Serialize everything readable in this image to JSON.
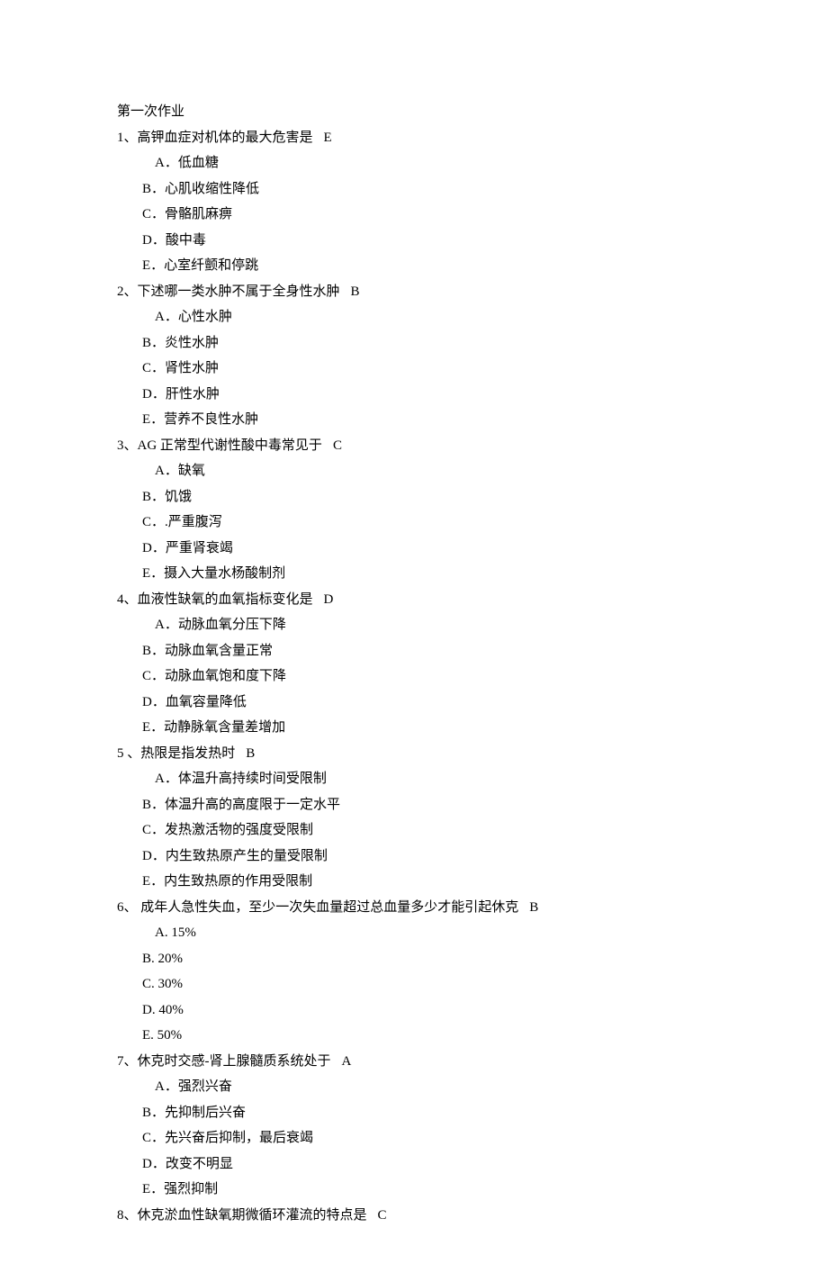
{
  "title": "第一次作业",
  "questions": [
    {
      "num": "1、",
      "stem": "高钾血症对机体的最大危害是",
      "answer": "E",
      "options": [
        "A．低血糖",
        "B．心肌收缩性降低",
        "C．骨骼肌麻痹",
        "D．酸中毒",
        "E．心室纤颤和停跳"
      ]
    },
    {
      "num": "2、",
      "stem": "下述哪一类水肿不属于全身性水肿",
      "answer": "B",
      "options": [
        "A．心性水肿",
        "B．炎性水肿",
        "C．肾性水肿",
        "D．肝性水肿",
        "E．营养不良性水肿"
      ]
    },
    {
      "num": "3、",
      "stem": "AG 正常型代谢性酸中毒常见于",
      "answer": "C",
      "options": [
        "A．缺氧",
        "B．饥饿",
        "C．.严重腹泻",
        "D．严重肾衰竭",
        "E．摄入大量水杨酸制剂"
      ]
    },
    {
      "num": "4、",
      "stem": "血液性缺氧的血氧指标变化是",
      "answer": "D",
      "options": [
        "A．动脉血氧分压下降",
        "B．动脉血氧含量正常",
        "C．动脉血氧饱和度下降",
        "D．血氧容量降低",
        "E．动静脉氧含量差增加"
      ]
    },
    {
      "num": "5 、",
      "stem": "热限是指发热时",
      "answer": "B",
      "options": [
        "A．体温升高持续时间受限制",
        "B．体温升高的高度限于一定水平",
        "C．发热激活物的强度受限制",
        "D．内生致热原产生的量受限制",
        "E．内生致热原的作用受限制"
      ]
    },
    {
      "num": "6、",
      "stem": " 成年人急性失血，至少一次失血量超过总血量多少才能引起休克",
      "answer": "B",
      "options": [
        "A. 15%",
        "B. 20%",
        "C. 30%",
        "D. 40%",
        "E. 50%"
      ]
    },
    {
      "num": "7、",
      "stem": "休克时交感-肾上腺髓质系统处于",
      "answer": "A",
      "options": [
        "A．强烈兴奋",
        "B．先抑制后兴奋",
        "C．先兴奋后抑制，最后衰竭",
        "D．改变不明显",
        "E．强烈抑制"
      ]
    },
    {
      "num": "8、",
      "stem": "休克淤血性缺氧期微循环灌流的特点是",
      "answer": "C",
      "options": []
    }
  ]
}
